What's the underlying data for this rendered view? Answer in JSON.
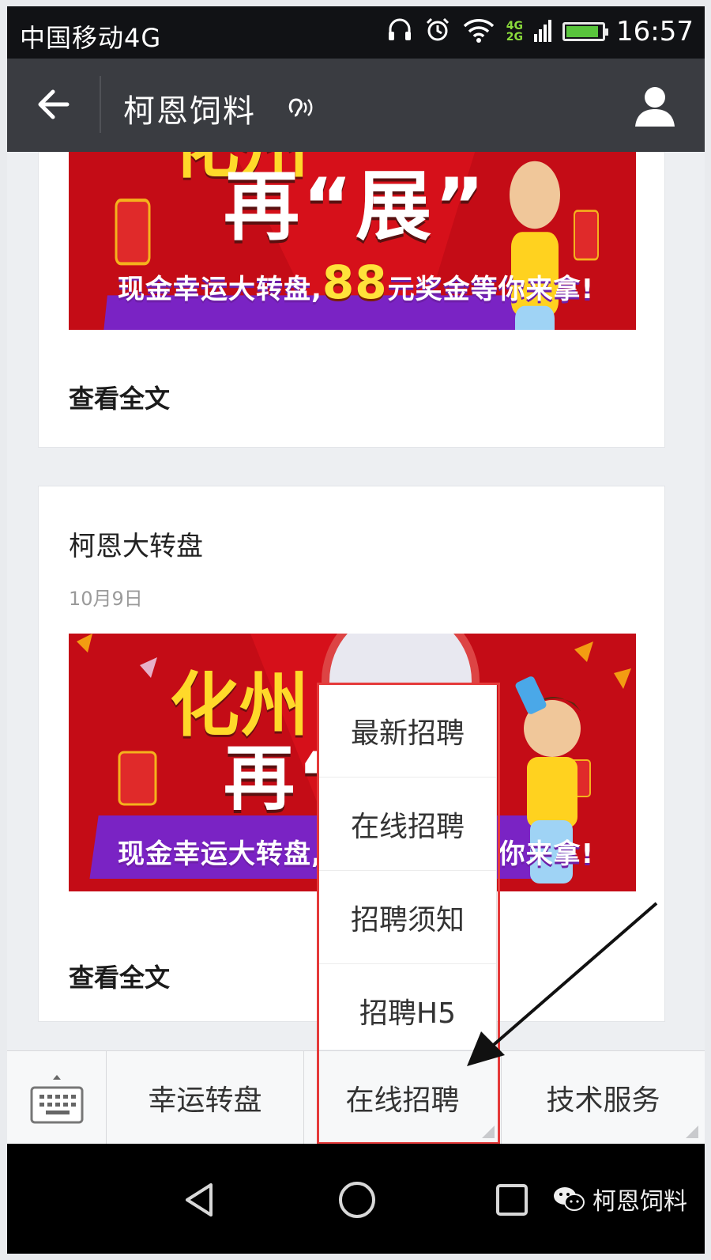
{
  "status_bar": {
    "carrier": "中国移动4G",
    "net_top": "4G",
    "net_bottom": "2G",
    "time": "16:57"
  },
  "title_bar": {
    "title": "柯恩饲料"
  },
  "banner": {
    "word_top": "化州",
    "word_main": "再“展”",
    "headline_prefix": "现金幸运大转盘,",
    "headline_number": "88",
    "headline_suffix": "元奖金等你来拿!"
  },
  "articles": [
    {
      "read_more": "查看全文"
    },
    {
      "title": "柯恩大转盘",
      "date": "10月9日",
      "read_more": "查看全文"
    }
  ],
  "popup_menu": {
    "items": [
      "最新招聘",
      "在线招聘",
      "招聘须知",
      "招聘H5"
    ]
  },
  "menu_bar": {
    "tabs": [
      "幸运转盘",
      "在线招聘",
      "技术服务"
    ]
  },
  "watermark": {
    "text": "柯恩饲料"
  },
  "colors": {
    "highlight": "#e53a3a",
    "title_bar": "#3a3c41",
    "banner_red": "#d6101a"
  }
}
